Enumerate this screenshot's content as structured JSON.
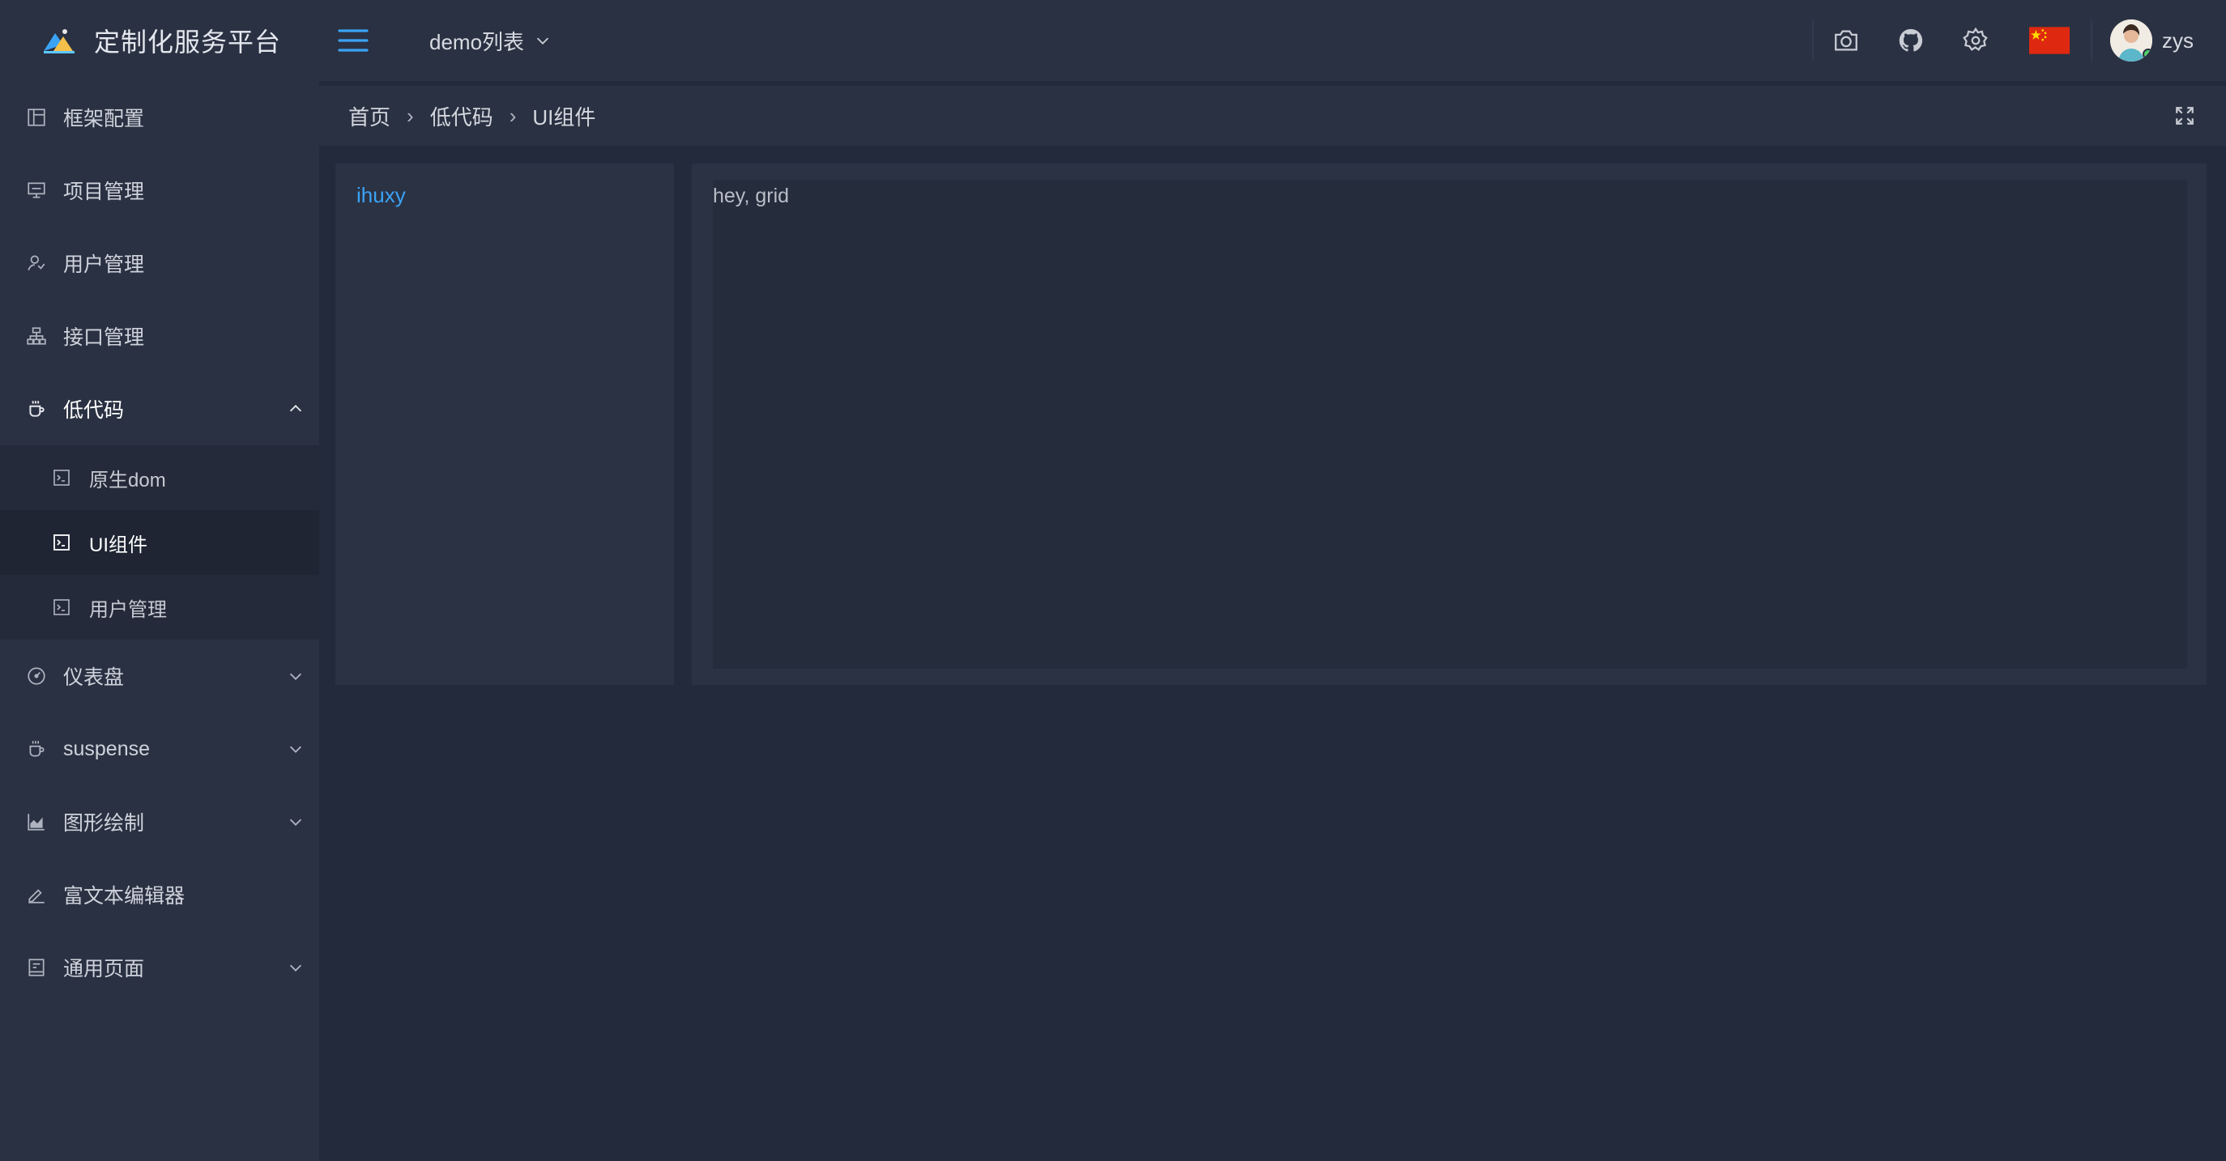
{
  "app": {
    "title": "定制化服务平台"
  },
  "header": {
    "project_select": "demo列表",
    "user_name": "zys"
  },
  "sidebar": {
    "items": [
      {
        "label": "框架配置",
        "icon": "layout-icon"
      },
      {
        "label": "项目管理",
        "icon": "monitor-icon"
      },
      {
        "label": "用户管理",
        "icon": "user-icon"
      },
      {
        "label": "接口管理",
        "icon": "network-icon"
      },
      {
        "label": "低代码",
        "icon": "cup-icon",
        "expanded": true,
        "children": [
          {
            "label": "原生dom",
            "icon": "terminal-icon"
          },
          {
            "label": "UI组件",
            "icon": "terminal-icon",
            "active": true
          },
          {
            "label": "用户管理",
            "icon": "terminal-icon"
          }
        ]
      },
      {
        "label": "仪表盘",
        "icon": "gauge-icon"
      },
      {
        "label": "suspense",
        "icon": "cup-icon"
      },
      {
        "label": "图形绘制",
        "icon": "chart-icon"
      },
      {
        "label": "富文本编辑器",
        "icon": "edit-icon"
      },
      {
        "label": "通用页面",
        "icon": "page-icon"
      }
    ]
  },
  "breadcrumb": {
    "items": [
      "首页",
      "低代码",
      "UI组件"
    ],
    "separator": "›"
  },
  "main": {
    "left_link": "ihuxy",
    "grid_text": "hey, grid"
  },
  "colors": {
    "accent": "#3aa3f5",
    "sidebar_bg": "#2a3142",
    "page_bg": "#232a3b"
  }
}
